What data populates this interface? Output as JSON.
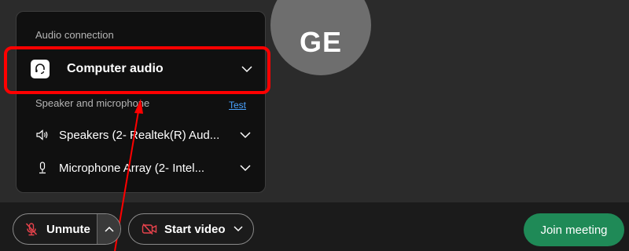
{
  "avatar": {
    "initials": "GE"
  },
  "audio_panel": {
    "connection_label": "Audio connection",
    "connection_value": "Computer audio",
    "speaker_mic_label": "Speaker and microphone",
    "test_link": "Test",
    "speaker_device": "Speakers (2- Realtek(R) Aud...",
    "microphone_device": "Microphone Array (2- Intel..."
  },
  "controls": {
    "unmute_label": "Unmute",
    "start_video_label": "Start video",
    "join_label": "Join meeting"
  },
  "colors": {
    "join_button": "#1f8a57",
    "highlight": "#ff0000",
    "link": "#4aa3ff"
  },
  "icons": [
    "headset-icon",
    "chevron-down-icon",
    "speaker-icon",
    "microphone-icon",
    "muted-microphone-icon",
    "chevron-up-icon",
    "video-off-icon"
  ]
}
